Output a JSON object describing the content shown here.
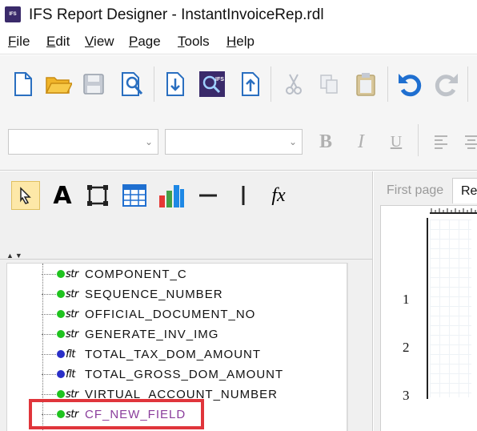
{
  "window": {
    "app_logo_text": "IFS",
    "title": "IFS Report Designer - InstantInvoiceRep.rdl"
  },
  "menu": [
    {
      "key": "F",
      "rest": "ile"
    },
    {
      "key": "E",
      "rest": "dit"
    },
    {
      "key": "V",
      "rest": "iew"
    },
    {
      "key": "P",
      "rest": "age"
    },
    {
      "key": "T",
      "rest": "ools"
    },
    {
      "key": "H",
      "rest": "elp"
    }
  ],
  "toolbar": {
    "icons": [
      "new-file-icon",
      "open-folder-icon",
      "save-icon",
      "print-preview-icon",
      "import-icon",
      "ifs-search-icon",
      "export-icon",
      "cut-icon",
      "copy-icon",
      "paste-icon",
      "undo-icon",
      "redo-icon"
    ]
  },
  "format_bar": {
    "font_name": "",
    "font_size": "",
    "bold": "B",
    "italic": "I",
    "underline": "U"
  },
  "palette": {
    "tools": [
      "pointer-icon",
      "text-icon",
      "rectangle-icon",
      "table-icon",
      "chart-icon",
      "horizontal-line-icon",
      "vertical-line-icon",
      "formula-icon"
    ],
    "text_tool_glyph": "A",
    "formula_glyph": "fx"
  },
  "tree": {
    "items": [
      {
        "type": "str",
        "name": "COMPONENT_C",
        "dot_color": "#1fc31f"
      },
      {
        "type": "str",
        "name": "SEQUENCE_NUMBER",
        "dot_color": "#1fc31f"
      },
      {
        "type": "str",
        "name": "OFFICIAL_DOCUMENT_NO",
        "dot_color": "#1fc31f"
      },
      {
        "type": "str",
        "name": "GENERATE_INV_IMG",
        "dot_color": "#1fc31f"
      },
      {
        "type": "flt",
        "name": "TOTAL_TAX_DOM_AMOUNT",
        "dot_color": "#2a2fc8"
      },
      {
        "type": "flt",
        "name": "TOTAL_GROSS_DOM_AMOUNT",
        "dot_color": "#2a2fc8"
      },
      {
        "type": "str",
        "name": "VIRTUAL_ACCOUNT_NUMBER",
        "dot_color": "#1fc31f"
      },
      {
        "type": "str",
        "name": "CF_NEW_FIELD",
        "dot_color": "#1fc31f",
        "highlighted": true
      }
    ],
    "highlight_color": "#e0353b",
    "custom_field_color": "#8a3d9c"
  },
  "tabs": [
    {
      "label": "First page",
      "active": false
    },
    {
      "label": "Re",
      "active": true
    }
  ],
  "ruler": {
    "marks": [
      "1",
      "2",
      "3"
    ]
  }
}
